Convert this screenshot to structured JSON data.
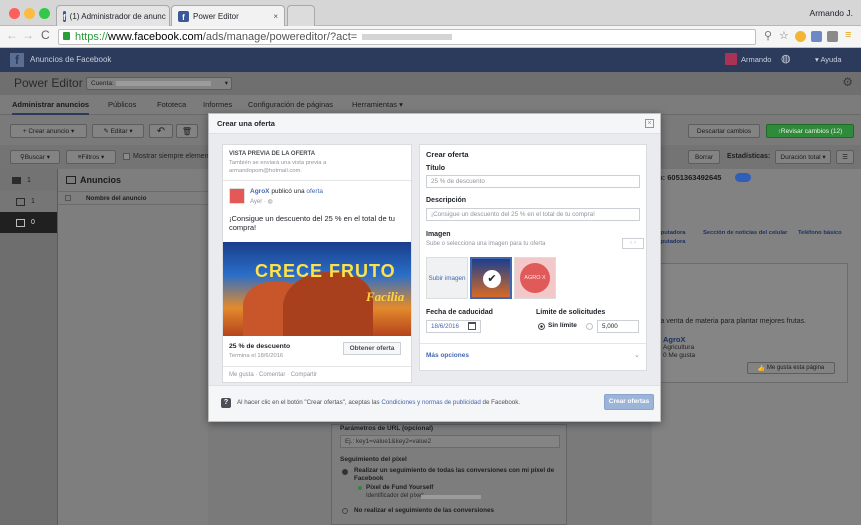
{
  "browser": {
    "tabs": [
      {
        "label": "(1) Administrador de anunc"
      },
      {
        "label": "Power Editor"
      }
    ],
    "user": "Armando J.",
    "url_prefix": "https://",
    "url_domain": "www.facebook.com",
    "url_path": "/ads/manage/powereditor/?act="
  },
  "fb_header": {
    "title": "Anuncios de Facebook",
    "user_name": "Armando",
    "help": "Ayuda"
  },
  "power_editor": {
    "title": "Power Editor",
    "account_label": "Cuenta:"
  },
  "nav_tabs": [
    "Administrar anuncios",
    "Públicos",
    "Fototeca",
    "Informes",
    "Configuración de páginas",
    "Herramientas"
  ],
  "toolbar": {
    "create_ad": "+ Crear anuncio",
    "edit": "Editar",
    "discard": "Descartar cambios",
    "review": "Revisar cambios (12)"
  },
  "filterbar": {
    "search": "Buscar",
    "filters": "Filtros",
    "show_always": "Mostrar siempre elementos",
    "clear": "Borrar",
    "stats_label": "Estadísticas:",
    "stats_value": "Duración total",
    "campaign_id": "io: 6051363492645"
  },
  "left_rows": [
    {
      "count": "1"
    },
    {
      "count": "1"
    },
    {
      "count": "0"
    }
  ],
  "grid": {
    "section_title": "Anuncios",
    "col_name": "Nombre del anuncio"
  },
  "right_panel": {
    "placements": [
      "omputadora",
      "Sección de noticias del celular",
      "Teléfono básico",
      "omputadora"
    ],
    "body_text": "la venta de materia para plantar mejores frutas.",
    "page_name": "AgroX",
    "page_category": "Agricultura",
    "page_likes": "0 Me gusta",
    "like_button": "Me gusta esta página"
  },
  "bottom_form": {
    "url_params_label": "Parámetros de URL (opcional)",
    "url_params_placeholder": "Ej.: key1=value1&key2=value2",
    "pixel_label": "Seguimiento del píxel",
    "option1": "Realizar un seguimiento de todas las conversiones con mi píxel de Facebook",
    "pixel_name": "Píxel de Fund Yourself",
    "pixel_id_label": "Identificador del píxel:",
    "option2": "No realizar el seguimiento de las conversiones"
  },
  "modal": {
    "title": "Crear una oferta",
    "preview": {
      "heading": "VISTA PREVIA DE LA OFERTA",
      "sub1": "También se enviará una vista previa a",
      "sub2": "armandopom@hotmail.com.",
      "page_name": "AgroX",
      "published": "publicó una",
      "offer_word": "oferta",
      "time": "Ayer",
      "message": "¡Consigue un descuento del 25 % en el total de tu compra!",
      "image_text": "CRECE FRUTO",
      "image_script": "Facilia",
      "offer_title": "25 % de descuento",
      "offer_expiry": "Termina el 18/6/2016",
      "get_offer": "Obtener oferta",
      "actions": "Me gusta · Comentar · Compartir"
    },
    "form": {
      "heading": "Crear oferta",
      "title_label": "Título",
      "title_value": "25 % de descuento",
      "desc_label": "Descripción",
      "desc_value": "¡Consigue un descuento del 25 % en el total de tu compra!",
      "image_label": "Imagen",
      "image_hint": "Sube o selecciona una imagen para tu oferta",
      "upload": "Subir imagen",
      "thumb2_text": "AGRO X",
      "expiry_label": "Fecha de caducidad",
      "expiry_value": "18/6/2016",
      "limit_label": "Límite de solicitudes",
      "no_limit": "Sin límite",
      "limit_value": "5,000",
      "more_options": "Más opciones"
    },
    "footer": {
      "text_before": "Al hacer clic en el botón \"Crear ofertas\", aceptas las",
      "terms_link": "Condiciones y normas de publicidad",
      "text_after": "de Facebook.",
      "create_button": "Crear ofertas"
    }
  },
  "colors": {
    "fb_blue": "#3b5998",
    "link_blue": "#4267b2",
    "green": "#2f8a3a"
  }
}
